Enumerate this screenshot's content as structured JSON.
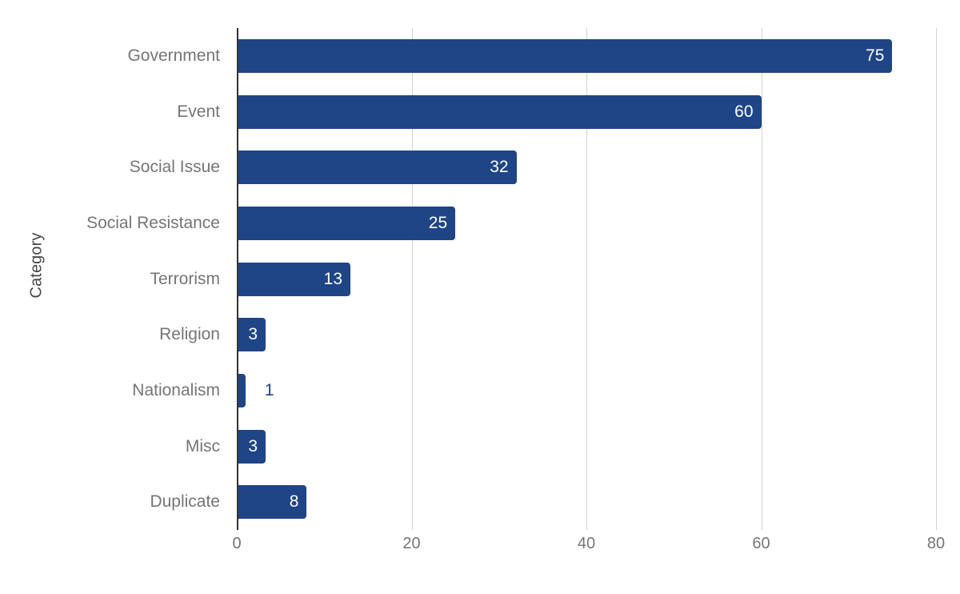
{
  "chart_data": {
    "type": "bar",
    "orientation": "horizontal",
    "title": "",
    "subtitle": "",
    "xlabel": "",
    "ylabel": "Category",
    "categories": [
      "Government",
      "Event",
      "Social Issue",
      "Social Resistance",
      "Terrorism",
      "Religion",
      "Nationalism",
      "Misc",
      "Duplicate"
    ],
    "values": [
      75,
      60,
      32,
      25,
      13,
      3,
      1,
      3,
      8
    ],
    "data_labels": [
      "75",
      "60",
      "32",
      "25",
      "13",
      "3",
      "1",
      "3",
      "8"
    ],
    "label_placement": [
      "inside",
      "inside",
      "inside",
      "inside",
      "inside",
      "inside",
      "outside",
      "inside",
      "inside"
    ],
    "xlim": [
      0,
      80
    ],
    "xticks": [
      0,
      20,
      40,
      60,
      80
    ],
    "xtick_labels": [
      "0",
      "20",
      "40",
      "60",
      "80"
    ],
    "grid": "vertical",
    "legend": "none",
    "series": [
      {
        "name": "Count",
        "color": "#1F4587",
        "values": [
          75,
          60,
          32,
          25,
          13,
          3,
          1,
          3,
          8
        ]
      }
    ]
  },
  "colors": {
    "bar": "#1F4587",
    "gridline": "#d3d3d3",
    "axis": "#333333",
    "tick_text": "#757575",
    "axis_title_text": "#444746",
    "value_inside_text": "#ffffff",
    "value_outside_text": "#1F4587",
    "background": "#ffffff"
  }
}
